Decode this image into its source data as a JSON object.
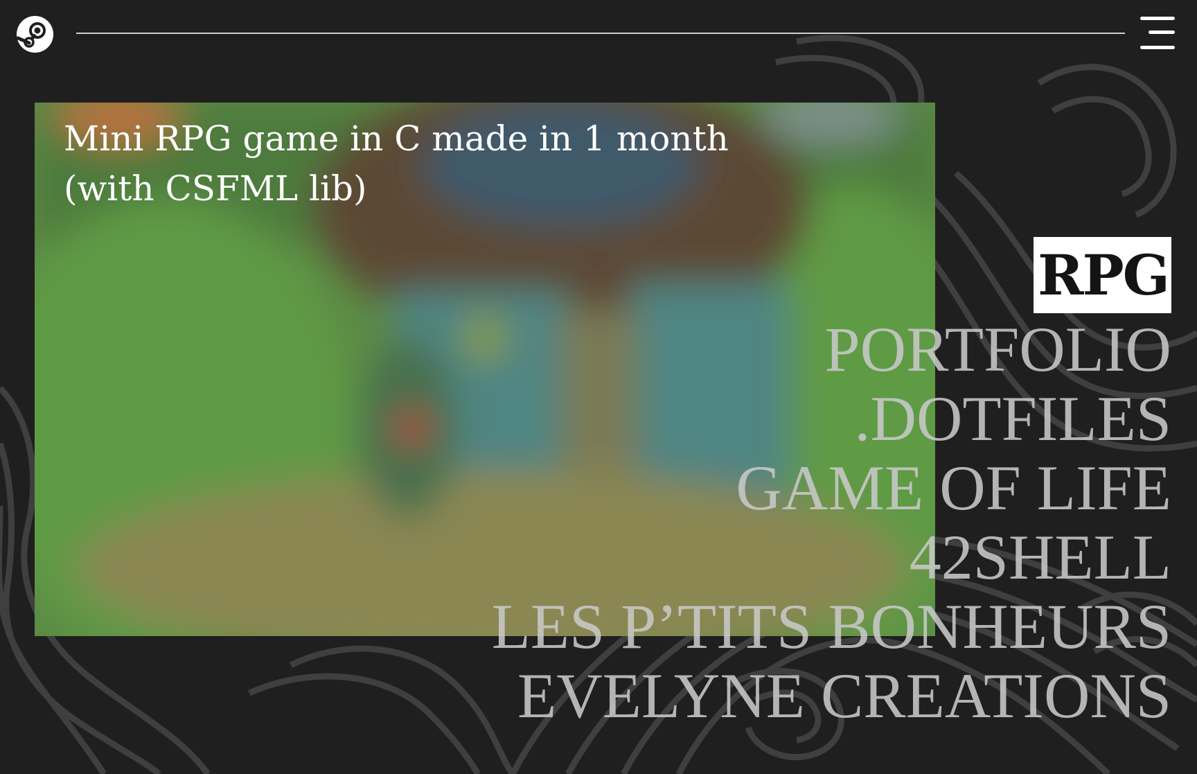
{
  "header": {
    "logo_icon": "steam-icon",
    "menu_icon": "hamburger-menu-icon"
  },
  "preview": {
    "caption": "Mini RPG game in C made in 1 month (with CSFML lib)"
  },
  "projects": [
    {
      "label": "RPG",
      "active": true
    },
    {
      "label": "PORTFOLIO",
      "active": false
    },
    {
      "label": ".DOTFILES",
      "active": false
    },
    {
      "label": "GAME OF LIFE",
      "active": false
    },
    {
      "label": "42SHELL",
      "active": false
    },
    {
      "label": "LES P’TITS BONHEURS",
      "active": false
    },
    {
      "label": "EVELYNE CREATIONS",
      "active": false
    }
  ],
  "colors": {
    "background": "#1f1f1f",
    "text_light": "#c9c9c9",
    "active_bg": "#ffffff",
    "active_text": "#141414"
  }
}
